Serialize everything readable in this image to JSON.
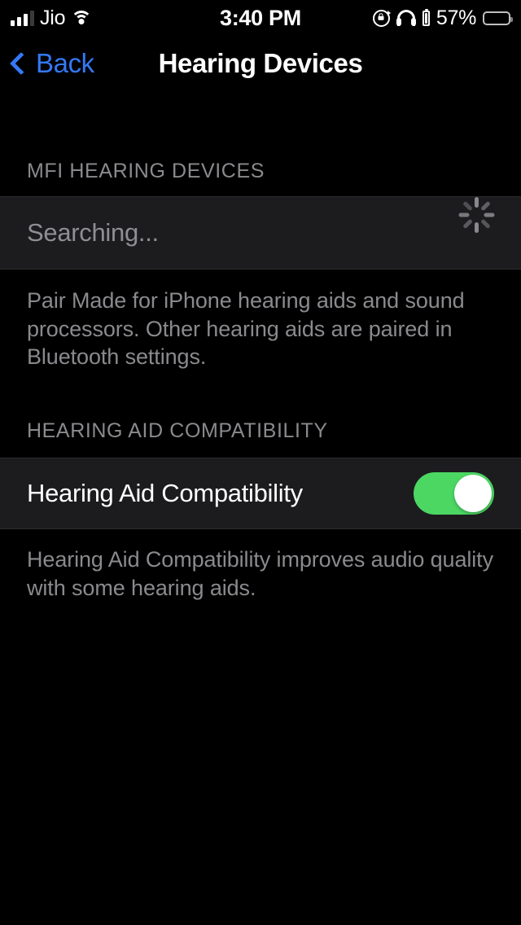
{
  "status_bar": {
    "carrier": "Jio",
    "time": "3:40 PM",
    "battery_percent": "57%",
    "signal_bars_filled": 3,
    "signal_bars_total": 4,
    "icons": [
      "cellular-signal-icon",
      "wifi-icon",
      "rotation-lock-icon",
      "headphones-icon",
      "headphones-battery-icon",
      "battery-icon"
    ]
  },
  "nav_bar": {
    "back_label": "Back",
    "title": "Hearing Devices",
    "back_tint": "#3478F6"
  },
  "sections": {
    "mfi": {
      "header": "MFI HEARING DEVICES",
      "row_label": "Searching...",
      "accessory": "activity-spinner",
      "footer": "Pair Made for iPhone hearing aids and sound processors. Other hearing aids are paired in Bluetooth settings."
    },
    "compatibility": {
      "header": "HEARING AID COMPATIBILITY",
      "row_label": "Hearing Aid Compatibility",
      "toggle_state": "on",
      "toggle_on_color": "#4CD763",
      "footer": "Hearing Aid Compatibility improves audio quality with some hearing aids."
    }
  }
}
